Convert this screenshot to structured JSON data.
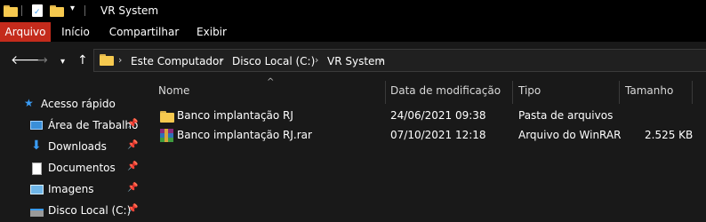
{
  "window": {
    "title": "VR System"
  },
  "ribbon": {
    "tabs": [
      "Arquivo",
      "Início",
      "Compartilhar",
      "Exibir"
    ]
  },
  "address": {
    "crumbs": [
      "Este Computador",
      "Disco Local (C:)",
      "VR System"
    ]
  },
  "nav": {
    "quick_access": "Acesso rápido",
    "items": [
      {
        "label": "Área de Trabalho",
        "icon": "desktop-icon",
        "pinned": true
      },
      {
        "label": "Downloads",
        "icon": "download-arrow-icon",
        "pinned": true
      },
      {
        "label": "Documentos",
        "icon": "document-icon",
        "pinned": true
      },
      {
        "label": "Imagens",
        "icon": "picture-icon",
        "pinned": true
      },
      {
        "label": "Disco Local (C:)",
        "icon": "drive-icon",
        "pinned": true
      }
    ]
  },
  "columns": {
    "name": "Nome",
    "modified": "Data de modificação",
    "type": "Tipo",
    "size": "Tamanho"
  },
  "files": [
    {
      "name": "Banco implantação RJ",
      "modified": "24/06/2021 09:38",
      "type": "Pasta de arquivos",
      "size": "",
      "icon": "folder-icon"
    },
    {
      "name": "Banco implantação RJ.rar",
      "modified": "07/10/2021 12:18",
      "type": "Arquivo do WinRAR",
      "size": "2.525 KB",
      "icon": "winrar-archive-icon"
    }
  ],
  "colors": {
    "background": "#191919",
    "titlebar": "#000000",
    "active_tab": "#c42b1c",
    "folder": "#f6c94f",
    "quick_access_star": "#3a9cf5"
  }
}
